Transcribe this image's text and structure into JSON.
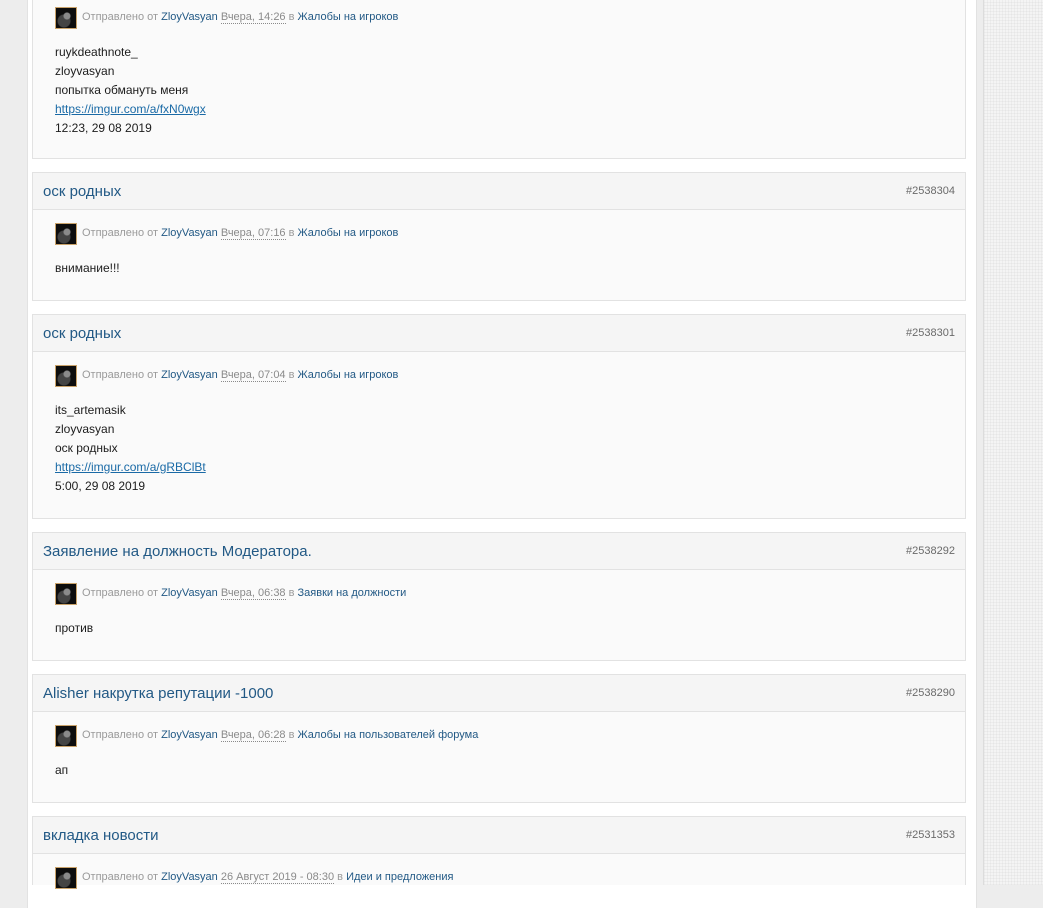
{
  "labels": {
    "sent_by": "Отправлено от",
    "in": "в"
  },
  "posts": [
    {
      "title": "",
      "id": "",
      "author": "ZloyVasyan",
      "date": "Вчера, 14:26",
      "forum": "Жалобы на игроков",
      "lines": [
        "ruykdeathnote_",
        "zloyvasyan",
        "попытка обмануть меня"
      ],
      "link": "https://imgur.com/a/fxN0wgx",
      "after": "12:23, 29 08 2019"
    },
    {
      "title": "оск родных",
      "id": "#2538304",
      "author": "ZloyVasyan",
      "date": "Вчера, 07:16",
      "forum": "Жалобы на игроков",
      "lines": [
        "внимание!!!"
      ]
    },
    {
      "title": "оск родных",
      "id": "#2538301",
      "author": "ZloyVasyan",
      "date": "Вчера, 07:04",
      "forum": "Жалобы на игроков",
      "lines": [
        "its_artemasik",
        "zloyvasyan",
        "оск родных"
      ],
      "link": "https://imgur.com/a/gRBClBt",
      "after": "5:00, 29 08 2019"
    },
    {
      "title": "Заявление на должность Модератора.",
      "id": "#2538292",
      "author": "ZloyVasyan",
      "date": "Вчера, 06:38",
      "forum": "Заявки на должности",
      "lines": [
        "против"
      ]
    },
    {
      "title": "Alisher накрутка репутации -1000",
      "id": "#2538290",
      "author": "ZloyVasyan",
      "date": "Вчера, 06:28",
      "forum": "Жалобы на пользователей форума",
      "lines": [
        "ап"
      ]
    },
    {
      "title": "вкладка новости",
      "id": "#2531353",
      "author": "ZloyVasyan",
      "date": "26 Август 2019 - 08:30",
      "forum": "Идеи и предложения",
      "lines": []
    }
  ]
}
